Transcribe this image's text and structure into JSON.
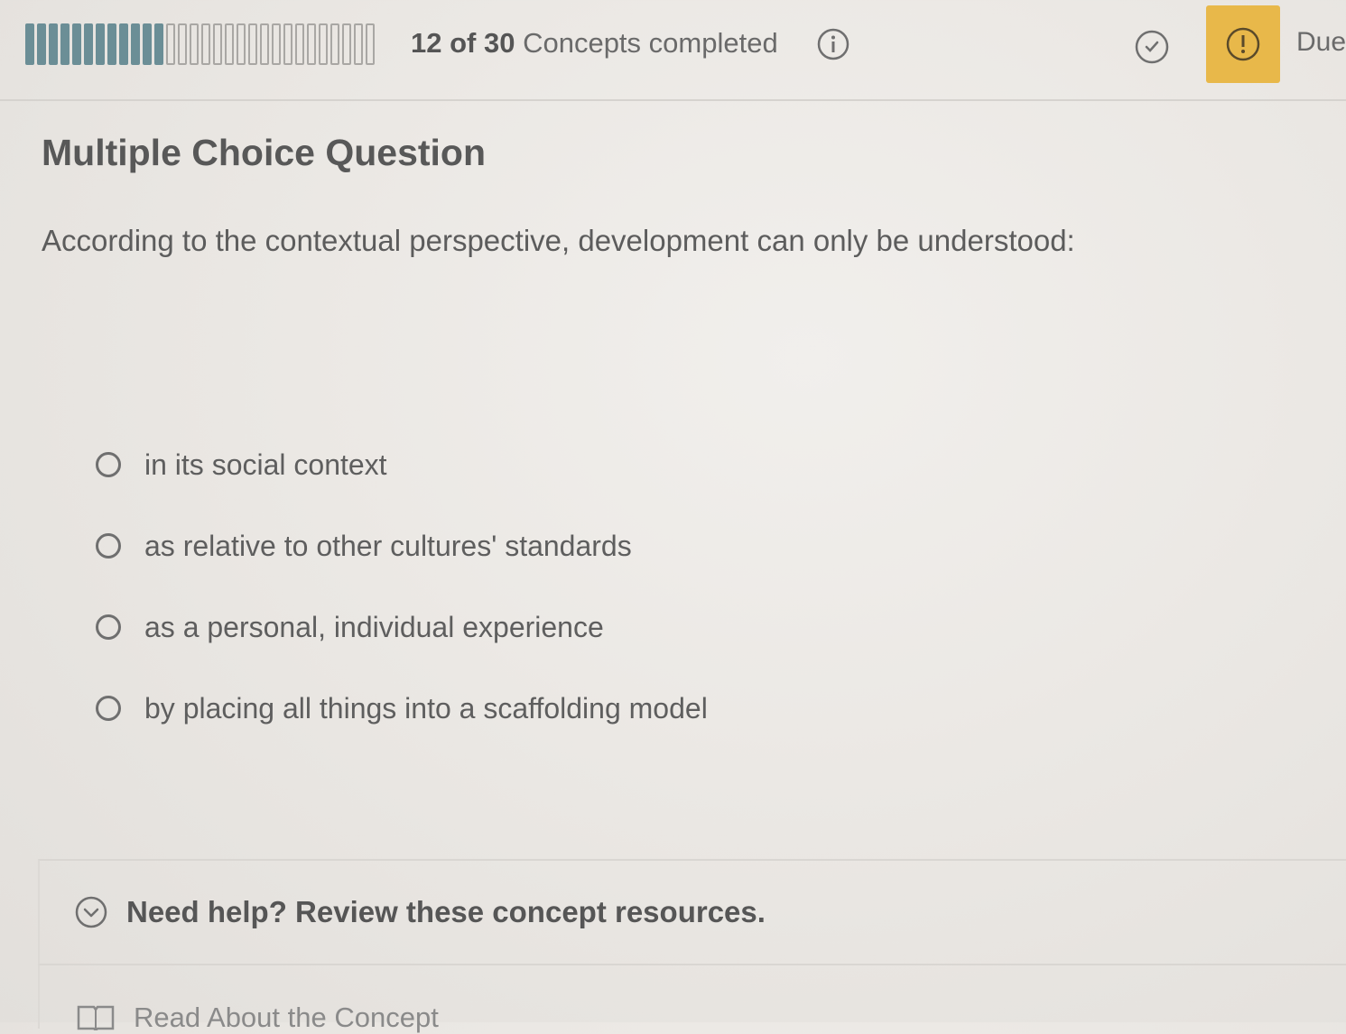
{
  "header": {
    "progress": {
      "completed": 12,
      "total": 30,
      "completed_label": "12 of 30",
      "suffix_label": "Concepts completed"
    },
    "due_label": "Due",
    "icons": {
      "info": "info-icon",
      "check": "check-circle-icon",
      "flag": "alert-icon"
    },
    "colors": {
      "progress_done": "#6b8e96",
      "flag_background": "#e8b84a"
    }
  },
  "question": {
    "type_label": "Multiple Choice Question",
    "prompt": "According to the contextual perspective, development can only be understood:",
    "options": [
      {
        "label": "in its social context",
        "selected": false
      },
      {
        "label": "as relative to other cultures' standards",
        "selected": false
      },
      {
        "label": "as a personal, individual experience",
        "selected": false
      },
      {
        "label": "by placing all things into a scaffolding model",
        "selected": false
      }
    ]
  },
  "help": {
    "title": "Need help? Review these concept resources.",
    "toggle_icon": "chevron-down-circle-icon",
    "resources": [
      {
        "label": "Read About the Concept",
        "icon": "book-icon"
      }
    ]
  }
}
